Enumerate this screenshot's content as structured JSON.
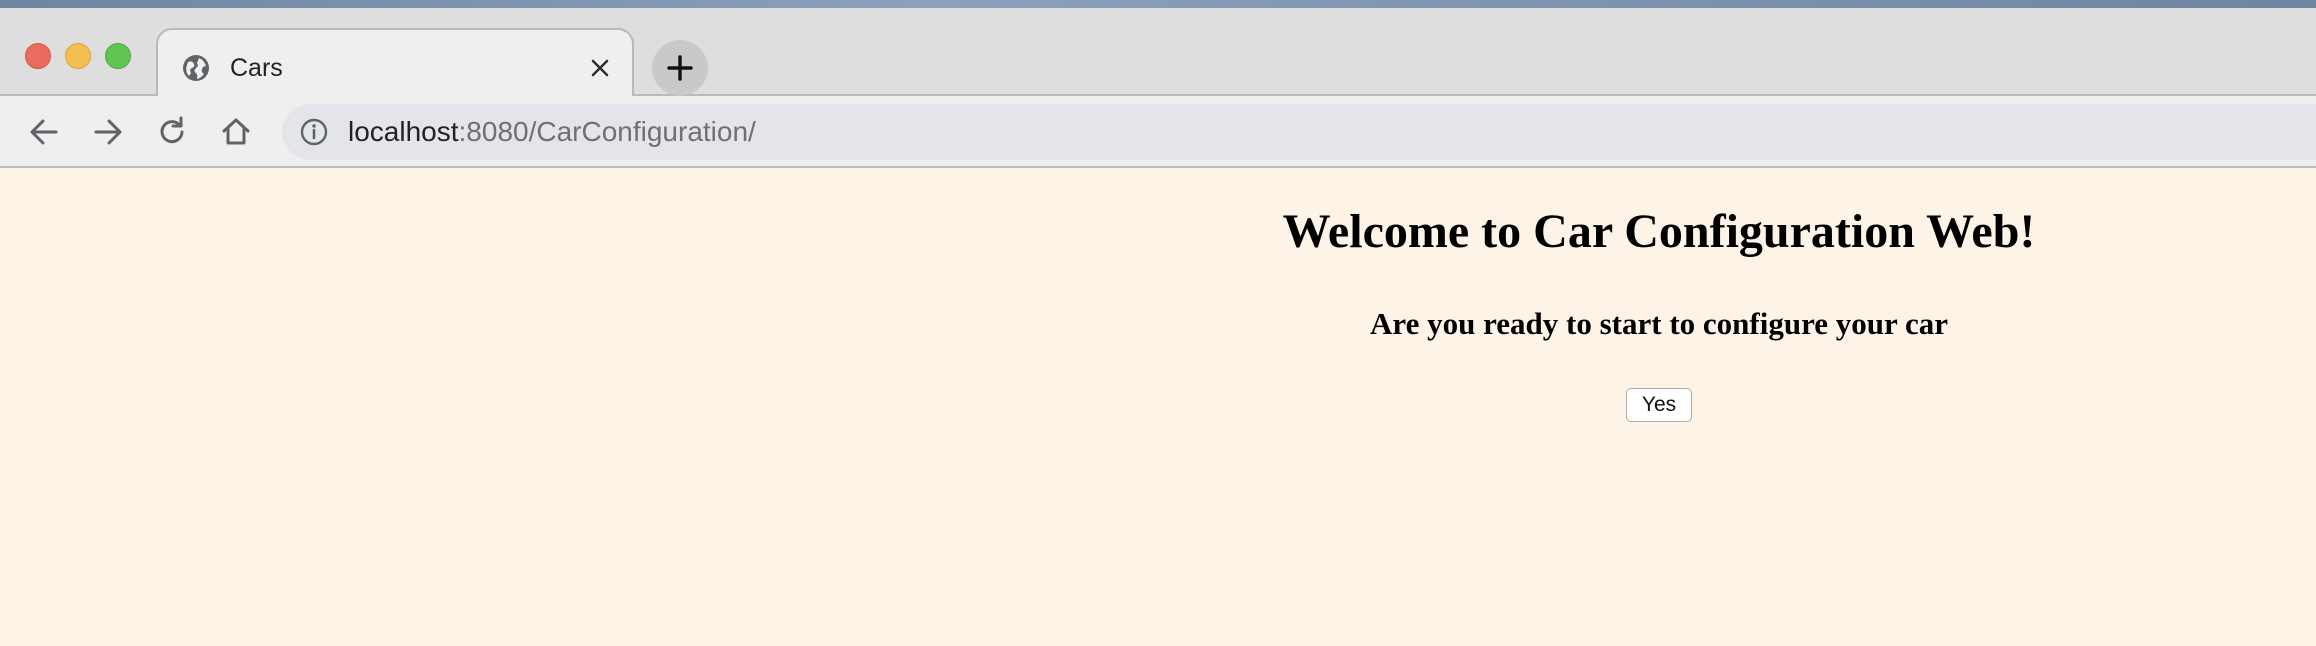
{
  "browser": {
    "tab": {
      "title": "Cars"
    },
    "address": {
      "host": "localhost",
      "path": ":8080/CarConfiguration/"
    },
    "icons": {
      "close": "close-icon",
      "new_tab": "plus-icon",
      "back": "arrow-left-icon",
      "forward": "arrow-right-icon",
      "reload": "reload-icon",
      "home": "home-icon",
      "info": "info-icon",
      "globe": "globe-icon"
    }
  },
  "page": {
    "heading": "Welcome to Car Configuration Web!",
    "subheading": "Are you ready to start to configure your car",
    "yes_button": "Yes",
    "background_color": "#fdf4e7"
  }
}
